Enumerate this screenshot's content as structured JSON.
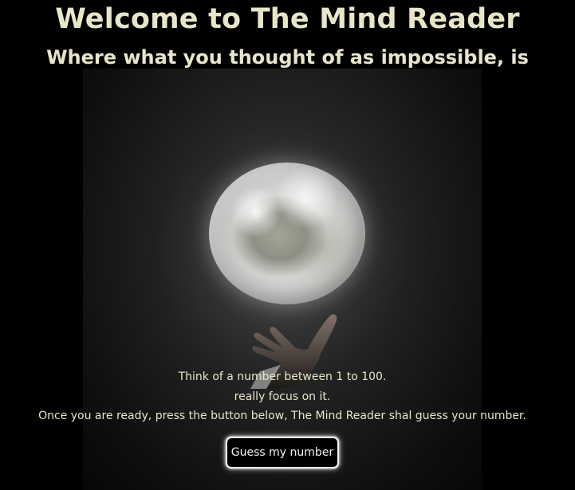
{
  "header": {
    "title": "Welcome to The Mind Reader",
    "subtitle": "Where what you thought of as impossible, is possible"
  },
  "hero_image": {
    "depicts": "moon-held-in-hand"
  },
  "instructions": {
    "line1": "Think of a number between 1 to 100.",
    "line2": "really focus on it.",
    "line3": "Once you are ready, press the button below, The Mind Reader shal guess your number."
  },
  "actions": {
    "guess_label": "Guess my number"
  },
  "colors": {
    "background": "#000000",
    "text": "#e8e6c9",
    "button_border": "#f2f2f2"
  }
}
